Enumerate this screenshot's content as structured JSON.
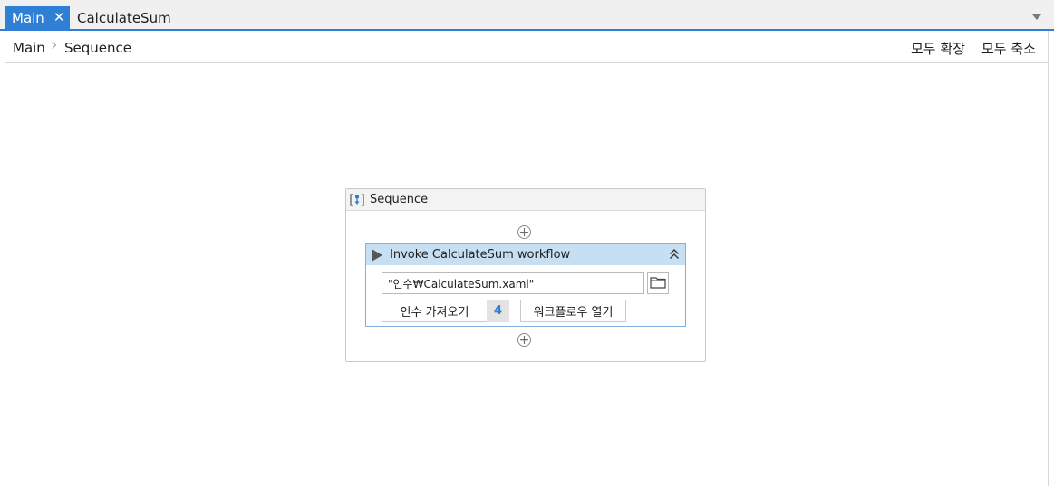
{
  "tabs": [
    {
      "label": "Main",
      "active": true
    },
    {
      "label": "CalculateSum",
      "active": false
    }
  ],
  "breadcrumb": [
    "Main",
    "Sequence"
  ],
  "toolbar": {
    "expand_all": "모두 확장",
    "collapse_all": "모두 축소"
  },
  "sequence": {
    "title": "Sequence",
    "invoke": {
      "title": "Invoke CalculateSum workflow",
      "path_value": "\"인수₩CalculateSum.xaml\"",
      "import_args_label": "인수 가져오기",
      "args_count": "4",
      "open_workflow_label": "워크플로우 열기"
    }
  },
  "colors": {
    "accent": "#2f7fd6",
    "invoke_header": "#c7dff2",
    "invoke_border": "#7fb3dd"
  },
  "icons": [
    "close-icon",
    "dropdown-arrow-icon",
    "chevron-right-icon",
    "sequence-icon",
    "add-activity-icon",
    "play-icon",
    "collapse-icon",
    "folder-icon"
  ]
}
